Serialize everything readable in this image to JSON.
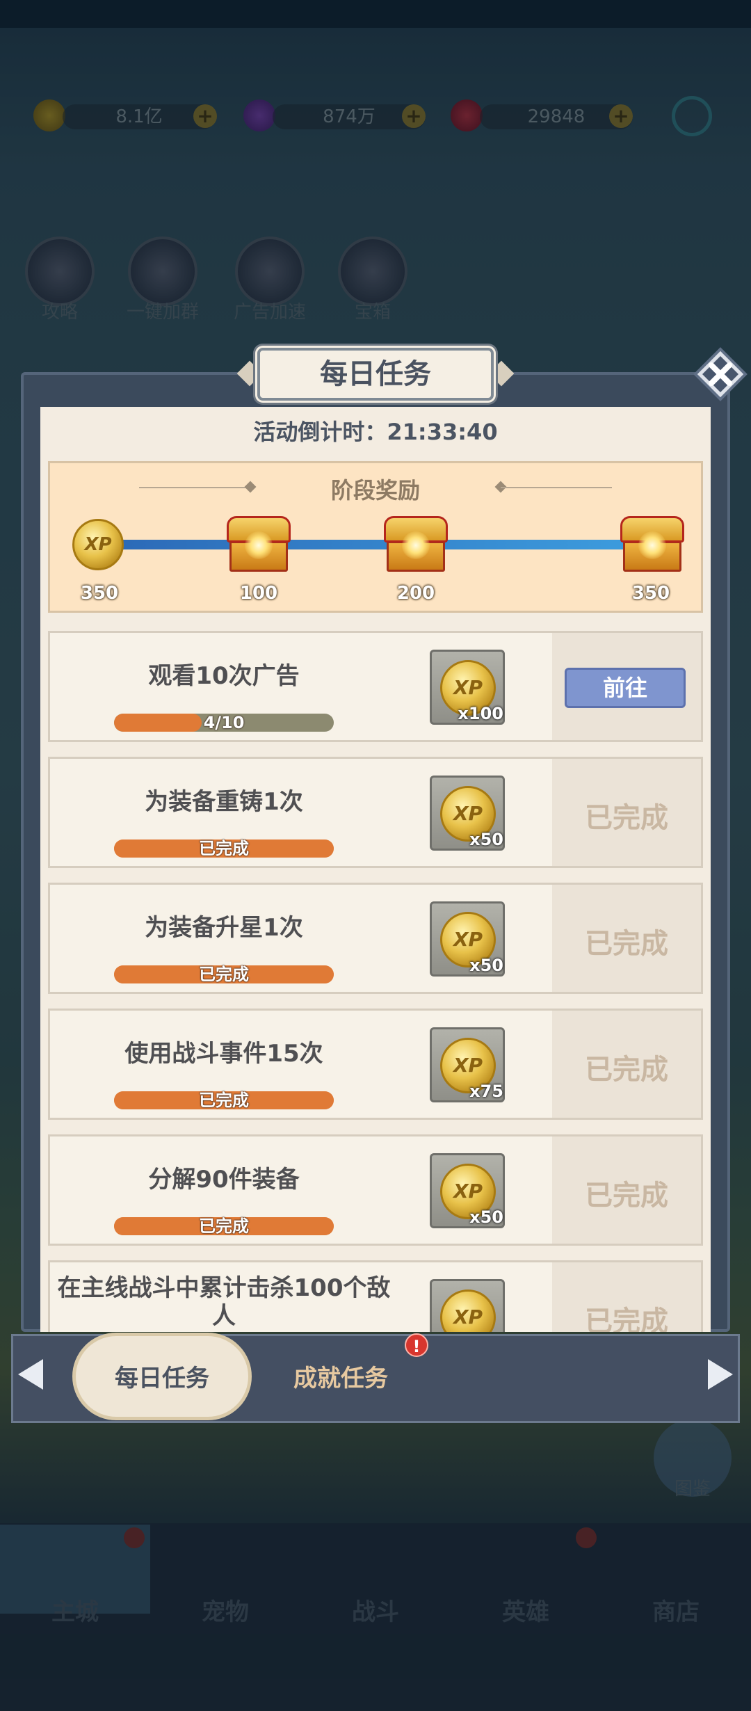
{
  "resources": [
    {
      "icon": "gold-coin-icon",
      "value": "8.1亿"
    },
    {
      "icon": "purple-gem-icon",
      "value": "874万"
    },
    {
      "icon": "red-diamond-icon",
      "value": "29848"
    }
  ],
  "activities": [
    {
      "icon": "book-icon",
      "label": "攻略"
    },
    {
      "icon": "qq-penguin-icon",
      "label": "一键加群"
    },
    {
      "icon": "dragon-icon",
      "label": "广告加速"
    },
    {
      "icon": "emblem-icon",
      "label": "宝箱"
    }
  ],
  "bottom_nav": [
    {
      "label": "主城"
    },
    {
      "label": "宠物"
    },
    {
      "label": "战斗"
    },
    {
      "label": "英雄"
    },
    {
      "label": "商店"
    }
  ],
  "right_side_button": "图鉴",
  "dialog": {
    "title": "每日任务",
    "countdown": "活动倒计时：21:33:40",
    "stage_title": "阶段奖励",
    "stage_rewards": [
      {
        "kind": "xp-coin-icon",
        "value": "350"
      },
      {
        "kind": "treasure-chest-icon",
        "value": "100"
      },
      {
        "kind": "treasure-chest-icon",
        "value": "200"
      },
      {
        "kind": "treasure-chest-icon",
        "value": "350"
      }
    ],
    "coin_text": "XP",
    "tasks": [
      {
        "name": "观看10次广告",
        "progress_text": "4/10",
        "progress": 0.4,
        "reward_qty": "x100",
        "action": "前往",
        "completed": false
      },
      {
        "name": "为装备重铸1次",
        "progress_text": "已完成",
        "progress": 1,
        "reward_qty": "x50",
        "action": "已完成",
        "completed": true
      },
      {
        "name": "为装备升星1次",
        "progress_text": "已完成",
        "progress": 1,
        "reward_qty": "x50",
        "action": "已完成",
        "completed": true
      },
      {
        "name": "使用战斗事件15次",
        "progress_text": "已完成",
        "progress": 1,
        "reward_qty": "x75",
        "action": "已完成",
        "completed": true
      },
      {
        "name": "分解90件装备",
        "progress_text": "已完成",
        "progress": 1,
        "reward_qty": "x50",
        "action": "已完成",
        "completed": true
      },
      {
        "name": "在主线战斗中累计击杀100个敌人",
        "action": "已完成",
        "completed": true
      }
    ],
    "tabs": [
      {
        "label": "每日任务",
        "active": true
      },
      {
        "label": "成就任务",
        "active": false,
        "badge": "!"
      }
    ]
  }
}
